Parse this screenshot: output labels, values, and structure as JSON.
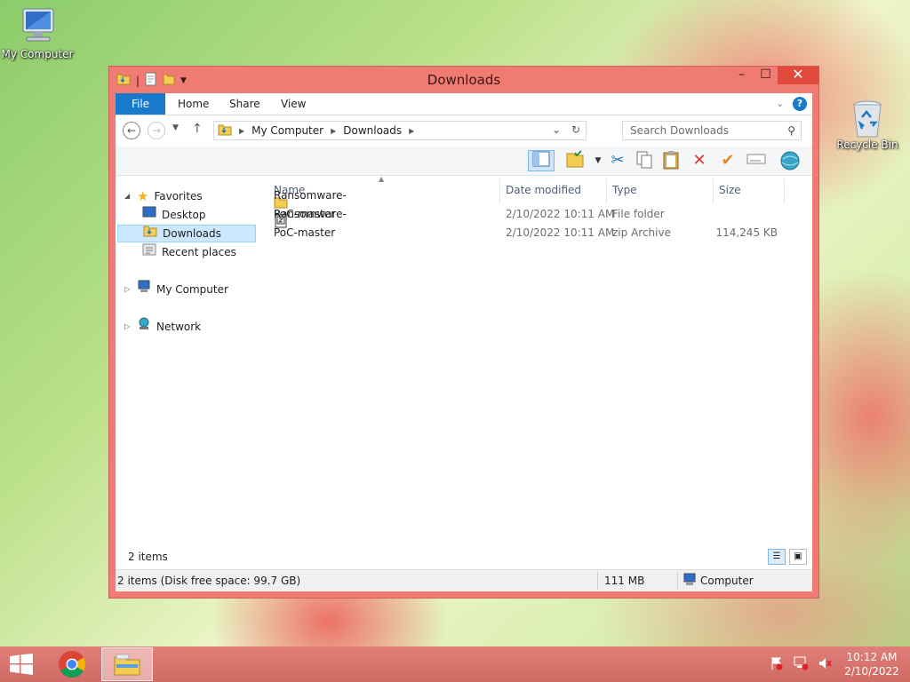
{
  "desktop": {
    "icons": [
      {
        "label": "My Computer",
        "icon": "computer-icon"
      },
      {
        "label": "Recycle Bin",
        "icon": "recycle-bin-icon"
      }
    ]
  },
  "window": {
    "title": "Downloads",
    "controls": {
      "minimize": "–",
      "maximize": "☐",
      "close": "✕"
    },
    "ribbon_tabs": [
      "File",
      "Home",
      "Share",
      "View"
    ],
    "nav": {
      "breadcrumb": [
        "My Computer",
        "Downloads"
      ],
      "search_placeholder": "Search Downloads"
    },
    "nav_pane": [
      {
        "label": "Favorites",
        "icon": "star-icon",
        "level": 0,
        "expanded": true
      },
      {
        "label": "Desktop",
        "icon": "desktop-icon",
        "level": 1
      },
      {
        "label": "Downloads",
        "icon": "downloads-folder-icon",
        "level": 1,
        "selected": true
      },
      {
        "label": "Recent places",
        "icon": "recent-places-icon",
        "level": 1
      },
      {
        "label": "My Computer",
        "icon": "computer-icon",
        "level": 0,
        "expanded": false
      },
      {
        "label": "Network",
        "icon": "network-icon",
        "level": 0,
        "expanded": false
      }
    ],
    "columns": [
      "Name",
      "Date modified",
      "Type",
      "Size"
    ],
    "files": [
      {
        "name": "Ransomware-PoC-master",
        "date": "2/10/2022 10:11 AM",
        "type": "File folder",
        "size": "",
        "icon": "folder-icon"
      },
      {
        "name": "Ransomware-PoC-master",
        "date": "2/10/2022 10:11 AM",
        "type": "zip Archive",
        "size": "114,245 KB",
        "icon": "zip-archive-icon"
      }
    ],
    "item_count": "2 items",
    "status": {
      "left": "2 items (Disk free space: 99.7 GB)",
      "size": "111 MB",
      "location": "Computer"
    }
  },
  "taskbar": {
    "clock_time": "10:12 AM",
    "clock_date": "2/10/2022"
  },
  "colors": {
    "accent": "#1979ca",
    "window_frame": "#f07b73",
    "close": "#e2493d"
  }
}
